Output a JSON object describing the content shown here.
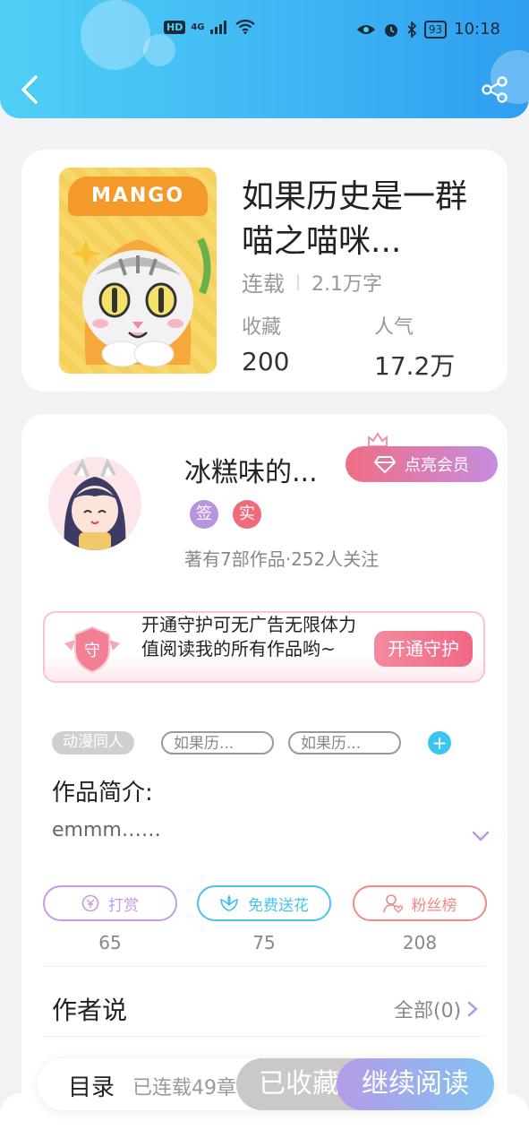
{
  "status_bar": {
    "hd": "HD",
    "network": "4G",
    "battery": "93",
    "time": "10:18"
  },
  "book": {
    "title": "如果历史是一群喵之喵咪...",
    "cover_text": "MANGO",
    "status": "连载",
    "word_count": "2.1万字",
    "favorites_label": "收藏",
    "favorites_value": "200",
    "popularity_label": "人气",
    "popularity_value": "17.2万"
  },
  "author": {
    "name": "冰糕味的...",
    "vip_button": "点亮会员",
    "badge_sign": "签",
    "badge_real": "实",
    "meta": "著有7部作品·252人关注"
  },
  "guard": {
    "icon_text": "守",
    "text": "开通守护可无广告无限体力值阅读我的所有作品哟~",
    "button": "开通守护"
  },
  "tags": [
    "动漫同人",
    "如果历...",
    "如果历..."
  ],
  "intro": {
    "title": "作品简介:",
    "text": "emmm……"
  },
  "actions": [
    {
      "label": "打赏",
      "count": "65",
      "color": "#c49be6"
    },
    {
      "label": "免费送花",
      "count": "75",
      "color": "#47c2ee"
    },
    {
      "label": "粉丝榜",
      "count": "208",
      "color": "#f08a8a"
    }
  ],
  "author_says": {
    "title": "作者说",
    "all_link": "全部(0)"
  },
  "bottom_bar": {
    "toc": "目录",
    "toc_sub": "已连载49章",
    "collected": "已收藏",
    "continue": "继续阅读"
  },
  "colors": {
    "header_start": "#4fd0f5",
    "header_end": "#2f9ef0",
    "accent_pink": "#f06785",
    "accent_blue": "#3cc6ef"
  }
}
